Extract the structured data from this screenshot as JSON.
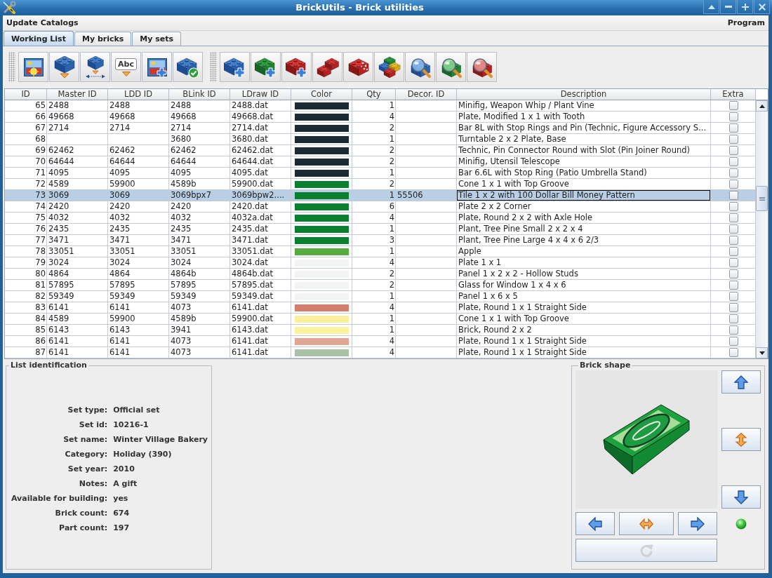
{
  "window": {
    "title": "BrickUtils - Brick utilities"
  },
  "menu_bar": [
    "Update Catalogs",
    "Program"
  ],
  "tabs": [
    {
      "label": "Working List",
      "selected": true
    },
    {
      "label": "My bricks",
      "selected": false
    },
    {
      "label": "My sets",
      "selected": false
    }
  ],
  "toolbar": {
    "text_icon_label": "Abc"
  },
  "table": {
    "columns": [
      "ID",
      "Master ID",
      "LDD ID",
      "BLink ID",
      "LDraw ID",
      "Color",
      "Qty",
      "Decor. ID",
      "Description",
      "Extra"
    ],
    "rows": [
      {
        "id": "65",
        "master_id": "2488",
        "ldd_id": "2488",
        "blink_id": "2488",
        "ldraw_id": "2488.dat",
        "color": "#1b2a34",
        "qty": "1",
        "description": "Minifig, Weapon Whip / Plant Vine",
        "extra": false,
        "selected": false
      },
      {
        "id": "66",
        "master_id": "49668",
        "ldd_id": "49668",
        "blink_id": "49668",
        "ldraw_id": "49668.dat",
        "color": "#1b2a34",
        "qty": "4",
        "description": "Plate, Modified 1 x 1 with Tooth",
        "extra": false,
        "selected": false
      },
      {
        "id": "67",
        "master_id": "2714",
        "ldd_id": "2714",
        "blink_id": "2714",
        "ldraw_id": "2714.dat",
        "color": "#1b2a34",
        "qty": "2",
        "description": "Bar 8L with Stop Rings and Pin (Technic, Figure Accessory S...",
        "extra": false,
        "selected": false
      },
      {
        "id": "68",
        "blink_id": "3680",
        "ldraw_id": "3680.dat",
        "color": "#1b2a34",
        "qty": "1",
        "description": "Turntable 2 x 2 Plate, Base",
        "extra": false,
        "selected": false
      },
      {
        "id": "69",
        "master_id": "62462",
        "ldd_id": "62462",
        "blink_id": "62462",
        "ldraw_id": "62462.dat",
        "color": "#1b2a34",
        "qty": "2",
        "description": "Technic, Pin Connector Round with Slot (Pin Joiner Round)",
        "extra": false,
        "selected": false
      },
      {
        "id": "70",
        "master_id": "64644",
        "ldd_id": "64644",
        "blink_id": "64644",
        "ldraw_id": "64644.dat",
        "color": "#1b2a34",
        "qty": "2",
        "description": "Minifig, Utensil Telescope",
        "extra": false,
        "selected": false
      },
      {
        "id": "71",
        "master_id": "4095",
        "ldd_id": "4095",
        "blink_id": "4095",
        "ldraw_id": "4095.dat",
        "color": "#1b2a34",
        "qty": "1",
        "description": "Bar 6.6L with Stop Ring (Patio Umbrella Stand)",
        "extra": false,
        "selected": false
      },
      {
        "id": "72",
        "master_id": "4589",
        "ldd_id": "59900",
        "blink_id": "4589b",
        "ldraw_id": "59900.dat",
        "color": "#0a7f30",
        "qty": "2",
        "description": "Cone 1 x 1 with Top Groove",
        "extra": false,
        "selected": false
      },
      {
        "id": "73",
        "master_id": "3069",
        "ldd_id": "3069",
        "blink_id": "3069bpx7",
        "ldraw_id": "3069bpw2....",
        "color": "#0a7f30",
        "qty": "1",
        "decor_id": "55506",
        "description": "Tile 1 x 2 with 100 Dollar Bill Money Pattern",
        "extra": false,
        "selected": true
      },
      {
        "id": "74",
        "master_id": "2420",
        "ldd_id": "2420",
        "blink_id": "2420",
        "ldraw_id": "2420.dat",
        "color": "#0a7f30",
        "qty": "6",
        "description": "Plate 2 x 2 Corner",
        "extra": false,
        "selected": false
      },
      {
        "id": "75",
        "master_id": "4032",
        "ldd_id": "4032",
        "blink_id": "4032",
        "ldraw_id": "4032a.dat",
        "color": "#0a7f30",
        "qty": "4",
        "description": "Plate, Round 2 x 2 with Axle Hole",
        "extra": false,
        "selected": false
      },
      {
        "id": "76",
        "master_id": "2435",
        "ldd_id": "2435",
        "blink_id": "2435",
        "ldraw_id": "2435.dat",
        "color": "#0a7f30",
        "qty": "1",
        "description": "Plant, Tree Pine Small 2 x 2 x 4",
        "extra": false,
        "selected": false
      },
      {
        "id": "77",
        "master_id": "3471",
        "ldd_id": "3471",
        "blink_id": "3471",
        "ldraw_id": "3471.dat",
        "color": "#0a7f30",
        "qty": "3",
        "description": "Plant, Tree Pine Large 4 x 4 x 6 2/3",
        "extra": false,
        "selected": false
      },
      {
        "id": "78",
        "master_id": "33051",
        "ldd_id": "33051",
        "blink_id": "33051",
        "ldraw_id": "33051.dat",
        "color": "#58ab41",
        "qty": "1",
        "description": "Apple",
        "extra": false,
        "selected": false
      },
      {
        "id": "79",
        "master_id": "3024",
        "ldd_id": "3024",
        "blink_id": "3024",
        "ldraw_id": "3024.dat",
        "color": "#f2f3f3",
        "qty": "4",
        "description": "Plate 1 x 1",
        "extra": false,
        "selected": false
      },
      {
        "id": "80",
        "master_id": "4864",
        "ldd_id": "4864",
        "blink_id": "4864b",
        "ldraw_id": "4864b.dat",
        "color": "#f2f3f3",
        "qty": "2",
        "description": "Panel 1 x 2 x 2 - Hollow Studs",
        "extra": false,
        "selected": false
      },
      {
        "id": "81",
        "master_id": "57895",
        "ldd_id": "57895",
        "blink_id": "57895",
        "ldraw_id": "57895.dat",
        "color": "#f2f3f3",
        "qty": "2",
        "description": "Glass for Window 1 x 4 x 6",
        "extra": false,
        "selected": false
      },
      {
        "id": "82",
        "master_id": "59349",
        "ldd_id": "59349",
        "blink_id": "59349",
        "ldraw_id": "59349.dat",
        "color": "#f2f3f3",
        "qty": "1",
        "description": "Panel 1 x 6 x 5",
        "extra": false,
        "selected": false
      },
      {
        "id": "83",
        "master_id": "6141",
        "ldd_id": "6141",
        "blink_id": "4073",
        "ldraw_id": "6141.dat",
        "color": "#d47e6c",
        "qty": "4",
        "description": "Plate, Round 1 x 1 Straight Side",
        "extra": false,
        "selected": false
      },
      {
        "id": "84",
        "master_id": "4589",
        "ldd_id": "59900",
        "blink_id": "4589b",
        "ldraw_id": "59900.dat",
        "color": "#fbf09c",
        "qty": "1",
        "description": "Cone 1 x 1 with Top Groove",
        "extra": false,
        "selected": false
      },
      {
        "id": "85",
        "master_id": "6143",
        "ldd_id": "6143",
        "blink_id": "3941",
        "ldraw_id": "6143.dat",
        "color": "#fbf2a0",
        "qty": "1",
        "description": "Brick, Round 2 x 2",
        "extra": false,
        "selected": false
      },
      {
        "id": "86",
        "master_id": "6141",
        "ldd_id": "6141",
        "blink_id": "4073",
        "ldraw_id": "6141.dat",
        "color": "#e0a795",
        "qty": "4",
        "description": "Plate, Round 1 x 1 Straight Side",
        "extra": false,
        "selected": false
      },
      {
        "id": "87",
        "master_id": "6141",
        "ldd_id": "6141",
        "blink_id": "4073",
        "ldraw_id": "6141.dat",
        "color": "#a9c2a6",
        "qty": "4",
        "description": "Plate, Round 1 x 1 Straight Side",
        "extra": false,
        "selected": false
      }
    ]
  },
  "list_identification": {
    "title": "List identification",
    "fields": [
      {
        "label": "Set type:",
        "value": "Official set"
      },
      {
        "label": "Set id:",
        "value": "10216-1"
      },
      {
        "label": "Set name:",
        "value": "Winter Village Bakery"
      },
      {
        "label": "Category:",
        "value": "Holiday (390)"
      },
      {
        "label": "Set year:",
        "value": "2010"
      },
      {
        "label": "Notes:",
        "value": "A gift"
      },
      {
        "label": "Available for building:",
        "value": "yes"
      },
      {
        "label": "Brick count:",
        "value": "674"
      },
      {
        "label": "Part count:",
        "value": "197"
      }
    ]
  },
  "brick_shape": {
    "title": "Brick shape",
    "indicator_on": true,
    "rotate_disabled": true
  }
}
